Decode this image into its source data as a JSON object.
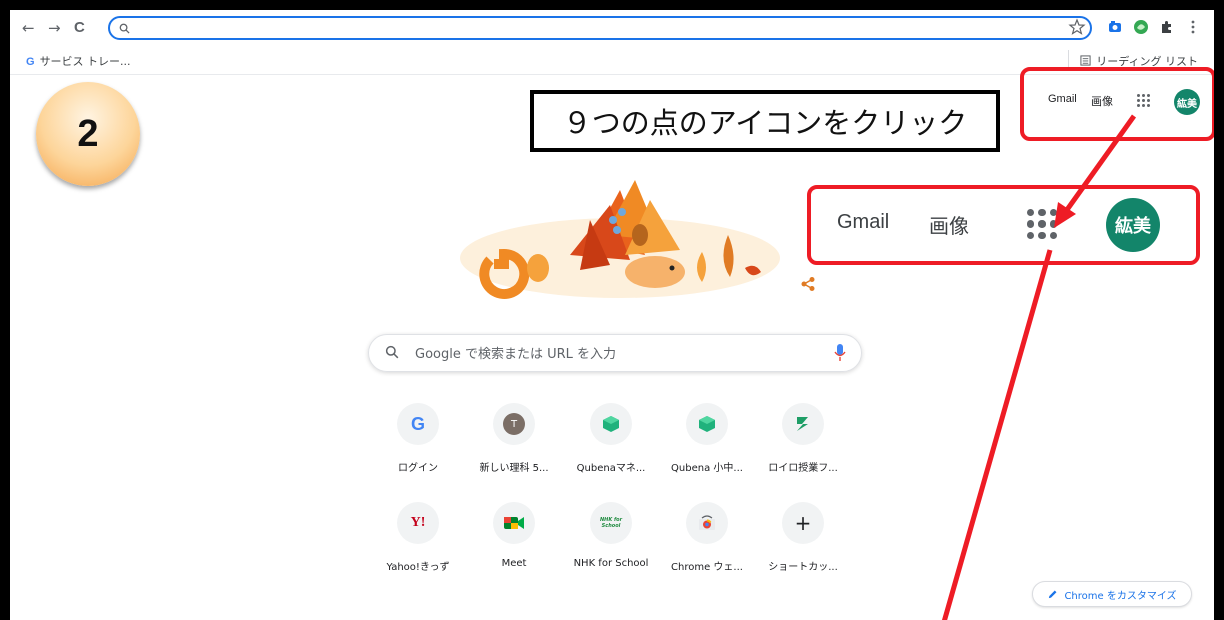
{
  "browser": {
    "back_icon": "←",
    "forward_icon": "→",
    "reload_icon": "C",
    "bookmark_item": "サービス トレー...",
    "bookmark_item_icon": "G",
    "reading_list": "リーディング リスト"
  },
  "header": {
    "gmail": "Gmail",
    "images": "画像",
    "avatar": "紘美"
  },
  "zoom": {
    "gmail": "Gmail",
    "images": "画像",
    "avatar": "紘美"
  },
  "step": {
    "number": "2",
    "callout": "９つの点のアイコンをクリック"
  },
  "search": {
    "placeholder": "Google で検索または URL を入力"
  },
  "shortcuts": [
    {
      "label": "ログイン",
      "icon": "G"
    },
    {
      "label": "新しい理科 5...",
      "icon": "T"
    },
    {
      "label": "Qubenaマネ...",
      "icon": "qubena-cube-icon"
    },
    {
      "label": "Qubena 小中...",
      "icon": "qubena-cube-icon"
    },
    {
      "label": "ロイロ授業フ...",
      "icon": "loilo-icon"
    },
    {
      "label": "Yahoo!きっず",
      "icon": "Y!"
    },
    {
      "label": "Meet",
      "icon": "meet-icon"
    },
    {
      "label": "NHK for School",
      "icon": "NHK for School"
    },
    {
      "label": "Chrome ウェ...",
      "icon": "chrome-webstore-icon"
    },
    {
      "label": "ショートカッ...",
      "icon": "+"
    }
  ],
  "customize_button": "Chrome をカスタマイズ",
  "colors": {
    "annotation_red": "#ee1c25",
    "avatar_green": "#13856a",
    "accent_blue": "#1a73e8"
  }
}
